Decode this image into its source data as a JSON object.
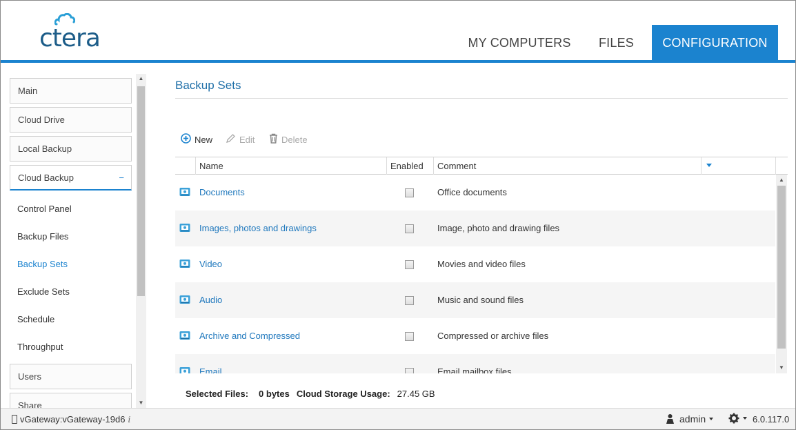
{
  "app": {
    "logo_text": "ctera"
  },
  "nav": {
    "tabs": [
      {
        "label": "MY COMPUTERS"
      },
      {
        "label": "FILES"
      },
      {
        "label": "CONFIGURATION",
        "active": true
      }
    ]
  },
  "sidebar": {
    "sections": [
      {
        "label": "Main"
      },
      {
        "label": "Cloud Drive"
      },
      {
        "label": "Local Backup"
      },
      {
        "label": "Cloud Backup",
        "collapse_glyph": "−"
      }
    ],
    "sub_items": [
      {
        "label": "Control Panel"
      },
      {
        "label": "Backup Files"
      },
      {
        "label": "Backup Sets",
        "active": true
      },
      {
        "label": "Exclude Sets"
      },
      {
        "label": "Schedule"
      },
      {
        "label": "Throughput"
      }
    ],
    "after_sections": [
      {
        "label": "Users"
      },
      {
        "label": "Share"
      }
    ]
  },
  "main": {
    "title": "Backup Sets",
    "toolbar": {
      "new_label": "New",
      "edit_label": "Edit",
      "delete_label": "Delete"
    },
    "grid": {
      "columns": {
        "name": "Name",
        "enabled": "Enabled",
        "comment": "Comment"
      },
      "rows": [
        {
          "name": "Documents",
          "enabled": false,
          "comment": "Office documents"
        },
        {
          "name": "Images, photos and drawings",
          "enabled": false,
          "comment": "Image, photo and drawing files"
        },
        {
          "name": "Video",
          "enabled": false,
          "comment": "Movies and video files"
        },
        {
          "name": "Audio",
          "enabled": false,
          "comment": "Music and sound files"
        },
        {
          "name": "Archive and Compressed",
          "enabled": false,
          "comment": "Compressed or archive files"
        },
        {
          "name": "Email",
          "enabled": false,
          "comment": "Email mailbox files"
        }
      ]
    },
    "summary": {
      "selected_label": "Selected Files:",
      "selected_value": "0 bytes",
      "usage_label": "Cloud Storage Usage:",
      "usage_value": "27.45 GB"
    }
  },
  "footer": {
    "device": "vGateway:vGateway-19d6",
    "user": "admin",
    "version": "6.0.117.0"
  },
  "colors": {
    "accent": "#1b83cf",
    "link": "#1f78bd"
  }
}
